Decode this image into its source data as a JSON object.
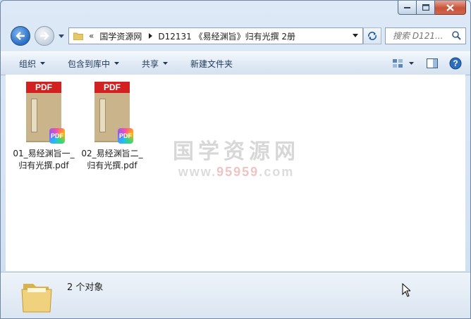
{
  "navigation": {
    "back_label": "Back",
    "forward_label": "Forward",
    "breadcrumbs": [
      {
        "label": "国学资源网"
      },
      {
        "label": "D12131 《易经渊旨》归有光撰 2册"
      }
    ],
    "search_placeholder": "搜索 D121..."
  },
  "toolbar": {
    "organize_label": "组织",
    "include_label": "包含到库中",
    "share_label": "共享",
    "new_folder_label": "新建文件夹",
    "view_icon": "view-options-icon",
    "pane_icon": "preview-pane-icon",
    "help_icon": "help-icon"
  },
  "files": [
    {
      "name_line1": "01_易经渊旨一_",
      "name_line2": "归有光撰.pdf",
      "badge": "PDF",
      "header": "PDF"
    },
    {
      "name_line1": "02_易经渊旨二_",
      "name_line2": "归有光撰.pdf",
      "badge": "PDF",
      "header": "PDF"
    }
  ],
  "watermark": {
    "title": "国学资源网",
    "url_prefix": "www.",
    "url_number": "95959",
    "url_suffix": ".com"
  },
  "details": {
    "count_text": "2 个对象"
  },
  "colors": {
    "accent": "#1e395b",
    "pdf_red": "#d12121",
    "close_button": "#c7533a"
  }
}
